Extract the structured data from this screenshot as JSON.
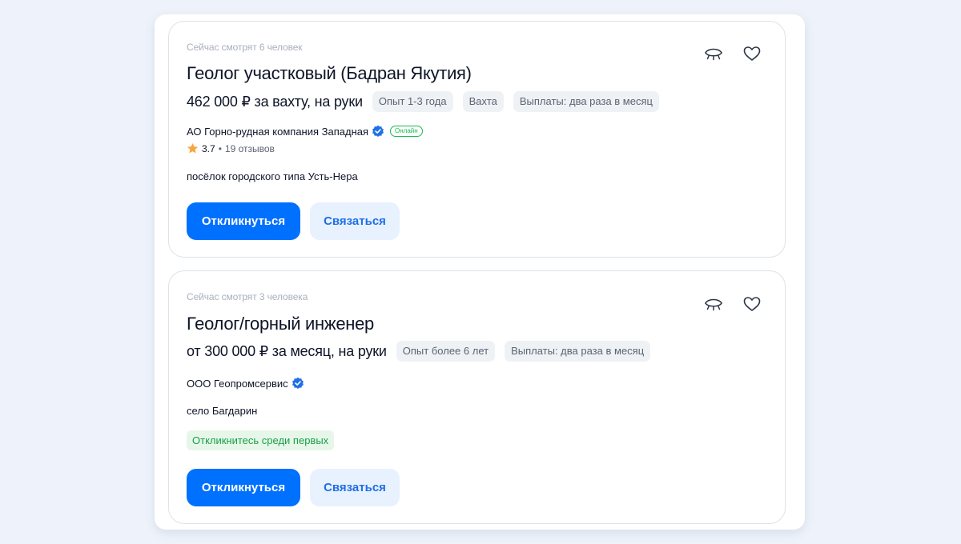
{
  "colors": {
    "background": "#eef3fb",
    "primary_button": "#0070ff",
    "secondary_button_bg": "#e8f1fe",
    "verified_badge": "#1f6fe5",
    "online": "#18b94f",
    "star": "#f7a63d",
    "first_badge_bg": "#e6f7ea",
    "first_badge_text": "#1a9e47"
  },
  "vacancies": [
    {
      "viewers": "Сейчас смотрят 6 человек",
      "title": "Геолог участковый (Бадран Якутия)",
      "salary": "462 000 ₽ за вахту, на руки",
      "chips": [
        "Опыт 1-3 года",
        "Вахта",
        "Выплаты: два раза в месяц"
      ],
      "company": "АО Горно-рудная компания Западная",
      "online_badge": "Онлайн",
      "rating": "3.7",
      "rating_sep": "•",
      "reviews": "19 отзывов",
      "location": "посёлок городского типа Усть-Нера",
      "respond_label": "Откликнуться",
      "contact_label": "Связаться",
      "icons": {
        "hide": "eye-closed-icon",
        "favorite": "heart-icon",
        "verified": "verified-check-icon",
        "star": "star-icon"
      }
    },
    {
      "viewers": "Сейчас смотрят 3 человека",
      "title": "Геолог/горный инженер",
      "salary": "от 300 000 ₽ за месяц, на руки",
      "chips": [
        "Опыт более 6 лет",
        "Выплаты: два раза в месяц"
      ],
      "company": "ООО Геопромсервис",
      "location": "село Багдарин",
      "first_badge": "Откликнитесь среди первых",
      "respond_label": "Откликнуться",
      "contact_label": "Связаться",
      "icons": {
        "hide": "eye-closed-icon",
        "favorite": "heart-icon",
        "verified": "verified-check-icon"
      }
    }
  ]
}
